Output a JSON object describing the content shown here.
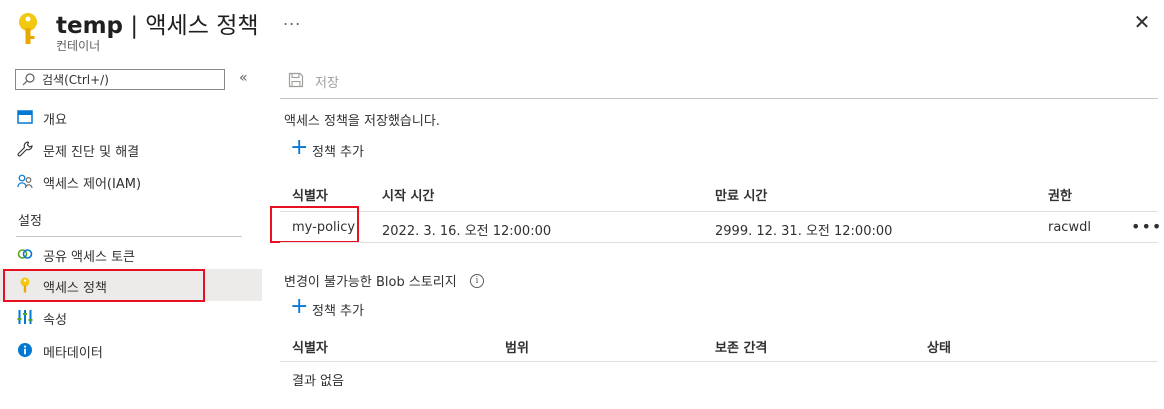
{
  "header": {
    "title_bold": "temp",
    "title_rest": " | 액세스 정책",
    "subtitle": "컨테이너",
    "more": "...",
    "close": "✕"
  },
  "sidebar": {
    "search_placeholder": "검색(Ctrl+/)",
    "collapse": "«",
    "items": [
      {
        "label": "개요",
        "icon": "overview-icon"
      },
      {
        "label": "문제 진단 및 해결",
        "icon": "wrench-icon"
      },
      {
        "label": "액세스 제어(IAM)",
        "icon": "people-icon"
      }
    ],
    "section": "설정",
    "settings_items": [
      {
        "label": "공유 액세스 토큰",
        "icon": "link-icon"
      },
      {
        "label": "액세스 정책",
        "icon": "key-icon",
        "active": true
      },
      {
        "label": "속성",
        "icon": "properties-icon"
      },
      {
        "label": "메타데이터",
        "icon": "info-icon"
      }
    ]
  },
  "toolbar": {
    "save_label": "저장"
  },
  "main": {
    "status_message": "액세스 정책을 저장했습니다.",
    "add_policy_label": "정책 추가",
    "policies": {
      "columns": [
        "식별자",
        "시작 시간",
        "만료 시간",
        "권한"
      ],
      "rows": [
        {
          "id": "my-policy",
          "start": "2022. 3. 16. 오전 12:00:00",
          "expiry": "2999. 12. 31. 오전 12:00:00",
          "permissions": "racwdl",
          "more": "•••"
        }
      ]
    },
    "immutable_title": "변경이 불가능한 Blob 스토리지",
    "info_glyph": "i",
    "immutable_add_label": "정책 추가",
    "immutable": {
      "columns": [
        "식별자",
        "범위",
        "보존 간격",
        "상태"
      ],
      "empty": "결과 없음"
    }
  },
  "colors": {
    "accent": "#0078d4",
    "key": "#f2c811",
    "highlight": "#e81123"
  }
}
